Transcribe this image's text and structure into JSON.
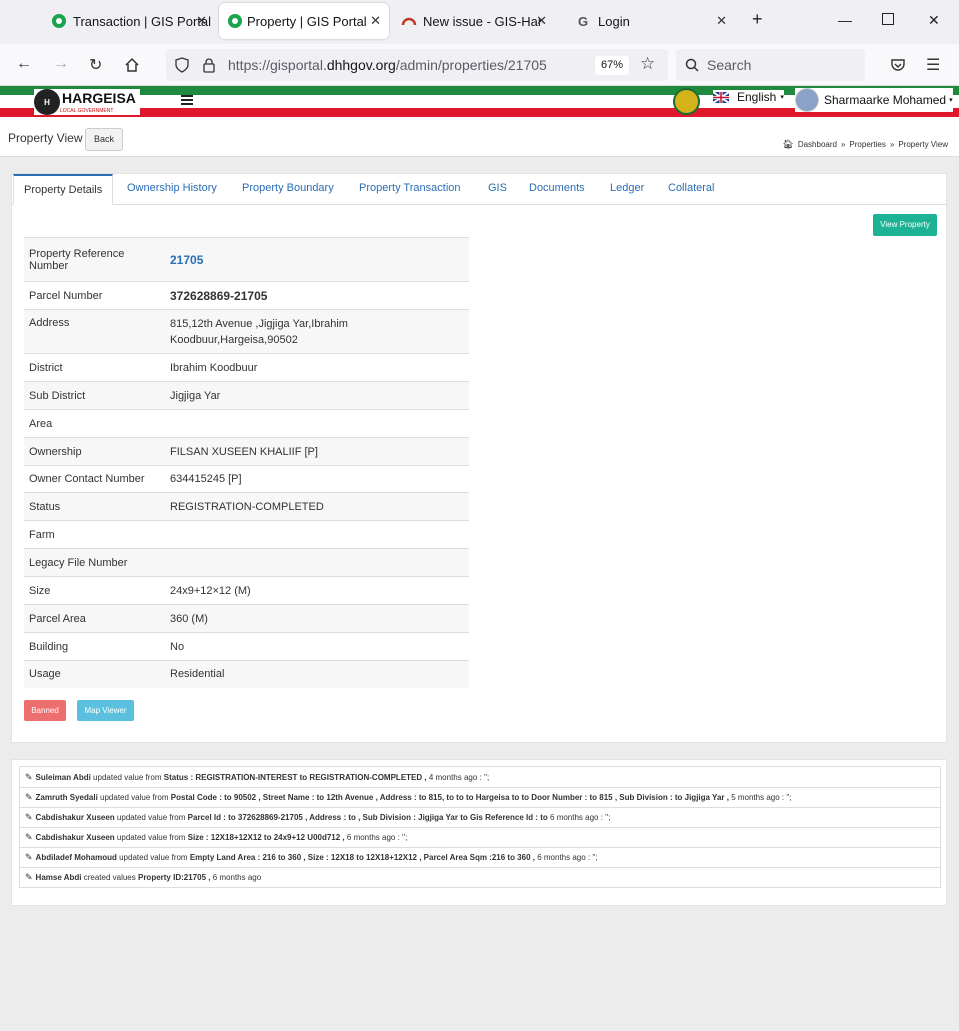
{
  "browser": {
    "tabs": [
      {
        "title": "Transaction | GIS Portal",
        "active": false
      },
      {
        "title": "Property | GIS Portal",
        "active": true
      },
      {
        "title": "New issue - GIS-Harge",
        "active": false
      },
      {
        "title": "Login",
        "active": false
      }
    ],
    "url_prefix": "https://gisportal.",
    "url_domain": "dhhgov.org",
    "url_path": "/admin/properties/21705",
    "zoom": "67%",
    "search_placeholder": "Search"
  },
  "header": {
    "logo_title": "HARGEISA",
    "logo_subtitle": "LOCAL GOVERNMENT",
    "language": "English",
    "user": "Sharmaarke Mohamed"
  },
  "page": {
    "title": "Property View",
    "back_label": "Back",
    "breadcrumb": [
      "Dashboard",
      "Properties",
      "Property View"
    ]
  },
  "tabs": [
    "Property Details",
    "Ownership History",
    "Property Boundary",
    "Property Transaction",
    "GIS",
    "Documents",
    "Ledger",
    "Collateral"
  ],
  "view_property_label": "View Property",
  "details": [
    {
      "label": "Property Reference Number",
      "value": "21705"
    },
    {
      "label": "Parcel Number",
      "value": "372628869-21705"
    },
    {
      "label": "Address",
      "value": "815,12th Avenue ,Jigjiga Yar,Ibrahim Koodbuur,Hargeisa,90502"
    },
    {
      "label": "District",
      "value": "Ibrahim Koodbuur"
    },
    {
      "label": "Sub District",
      "value": "Jigjiga Yar"
    },
    {
      "label": "Area",
      "value": ""
    },
    {
      "label": "Ownership",
      "value": "FILSAN XUSEEN KHALIIF [P]"
    },
    {
      "label": "Owner Contact Number",
      "value": "634415245 [P]"
    },
    {
      "label": "Status",
      "value": "REGISTRATION-COMPLETED"
    },
    {
      "label": "Farm",
      "value": ""
    },
    {
      "label": "Legacy File Number",
      "value": ""
    },
    {
      "label": "Size",
      "value": "24x9+12×12 (M)"
    },
    {
      "label": "Parcel Area",
      "value": "360 (M)"
    },
    {
      "label": "Building",
      "value": "No"
    },
    {
      "label": "Usage",
      "value": "Residential"
    }
  ],
  "buttons": {
    "banned": "Banned",
    "map_viewer": "Map Viewer"
  },
  "activity": [
    {
      "user": "Suleiman Abdi",
      "action": "updated value from",
      "detail": "Status : REGISTRATION-INTEREST to REGISTRATION-COMPLETED ,",
      "time": "4 months ago : '';"
    },
    {
      "user": "Zamruth Syedali",
      "action": "updated value from",
      "detail": "Postal Code : to 90502 , Street Name : to 12th Avenue , Address : to 815, to to to Hargeisa to to Door Number : to 815 , Sub Division : to Jigjiga Yar ,",
      "time": "5 months ago : '';"
    },
    {
      "user": "Cabdishakur Xuseen",
      "action": "updated value from",
      "detail": "Parcel Id : to 372628869-21705 , Address : to , Sub Division : Jigjiga Yar to Gis Reference Id : to",
      "time": "6 months ago : '';"
    },
    {
      "user": "Cabdishakur Xuseen",
      "action": "updated value from",
      "detail": "Size : 12X18+12X12 to 24x9+12 U00d712 ,",
      "time": "6 months ago : '';"
    },
    {
      "user": "Abdiladef Mohamoud",
      "action": "updated value from",
      "detail": "Empty Land Area : 216 to 360 , Size : 12X18 to 12X18+12X12 , Parcel Area Sqm :216 to 360 ,",
      "time": "6 months ago : '';"
    },
    {
      "user": "Hamse Abdi",
      "action": "created values",
      "detail": "Property ID:21705 ,",
      "time": "6 months ago"
    }
  ]
}
